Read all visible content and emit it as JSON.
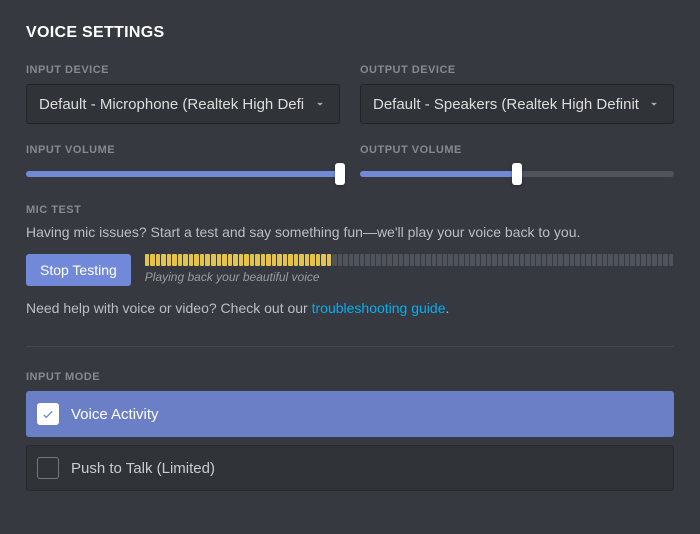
{
  "title": "VOICE SETTINGS",
  "input_device": {
    "label": "INPUT DEVICE",
    "value": "Default - Microphone (Realtek High Defini"
  },
  "output_device": {
    "label": "OUTPUT DEVICE",
    "value": "Default - Speakers (Realtek High Definition"
  },
  "input_volume": {
    "label": "INPUT VOLUME",
    "percent": 100
  },
  "output_volume": {
    "label": "OUTPUT VOLUME",
    "percent": 50
  },
  "mic_test": {
    "label": "MIC TEST",
    "desc": "Having mic issues? Start a test and say something fun—we'll play your voice back to you.",
    "button": "Stop Testing",
    "meter_active": 34,
    "meter_total": 96,
    "playing": "Playing back your beautiful voice"
  },
  "help": {
    "prefix": "Need help with voice or video? Check out our ",
    "link": "troubleshooting guide",
    "suffix": "."
  },
  "input_mode": {
    "label": "INPUT MODE",
    "options": [
      {
        "label": "Voice Activity",
        "selected": true
      },
      {
        "label": "Push to Talk (Limited)",
        "selected": false
      }
    ]
  }
}
